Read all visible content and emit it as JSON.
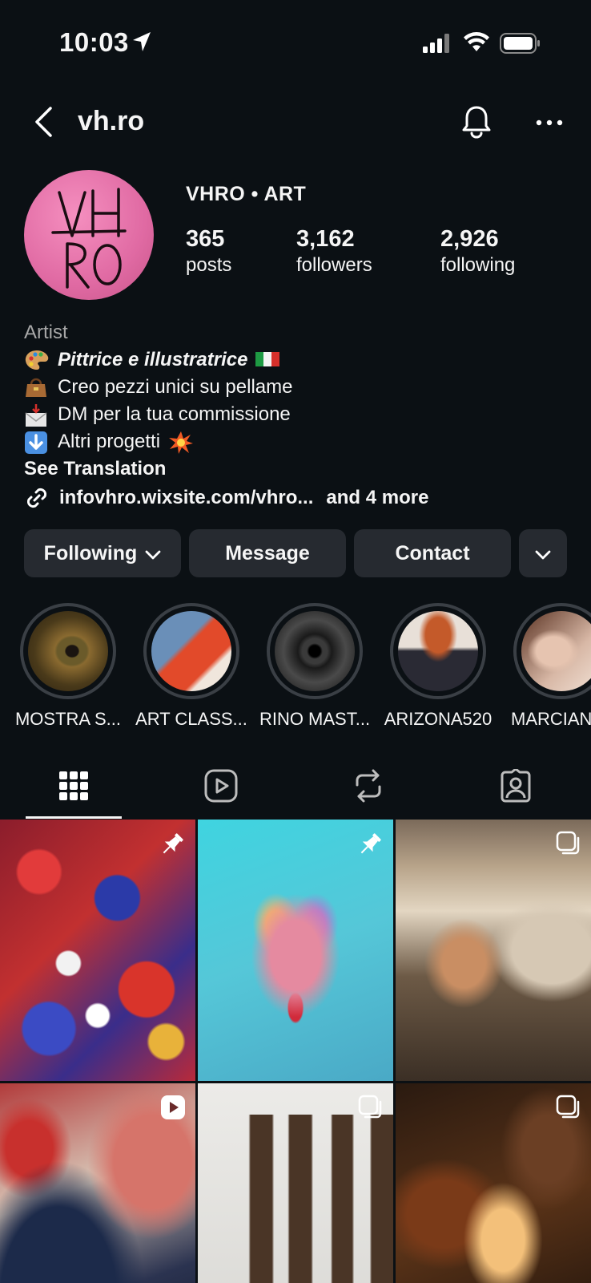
{
  "status_bar": {
    "time": "10:03"
  },
  "header": {
    "username": "vh.ro"
  },
  "profile": {
    "display_name": "VHRO • ART",
    "stats": [
      {
        "value": "365",
        "label": "posts"
      },
      {
        "value": "3,162",
        "label": "followers"
      },
      {
        "value": "2,926",
        "label": "following"
      }
    ],
    "category": "Artist",
    "bio_lines": [
      "Pittrice e illustratrice",
      "Creo pezzi unici su pellame",
      "DM per la tua commissione",
      "Altri progetti"
    ],
    "see_translation": "See Translation",
    "link_text": "infovhro.wixsite.com/vhro...",
    "link_more": "and 4 more",
    "avatar_text": "VH RO"
  },
  "actions": {
    "following": "Following",
    "message": "Message",
    "contact": "Contact"
  },
  "highlights": [
    {
      "label": "MOSTRA S..."
    },
    {
      "label": "ART CLASS..."
    },
    {
      "label": "RINO MAST..."
    },
    {
      "label": "ARIZONA520"
    },
    {
      "label": "MARCIAN"
    }
  ],
  "tabs": [
    "grid-icon",
    "reels-icon",
    "reposts-icon",
    "tagged-icon"
  ],
  "colors": {
    "background": "#0b1014",
    "button": "#262a30",
    "avatar": "#e87ab0",
    "muted_text": "#a8a8a8"
  },
  "posts": [
    {
      "badge": "pin-icon"
    },
    {
      "badge": "pin-icon"
    },
    {
      "badge": "carousel-icon"
    },
    {
      "badge": "reel-icon"
    },
    {
      "badge": "carousel-icon"
    },
    {
      "badge": "carousel-icon"
    }
  ]
}
